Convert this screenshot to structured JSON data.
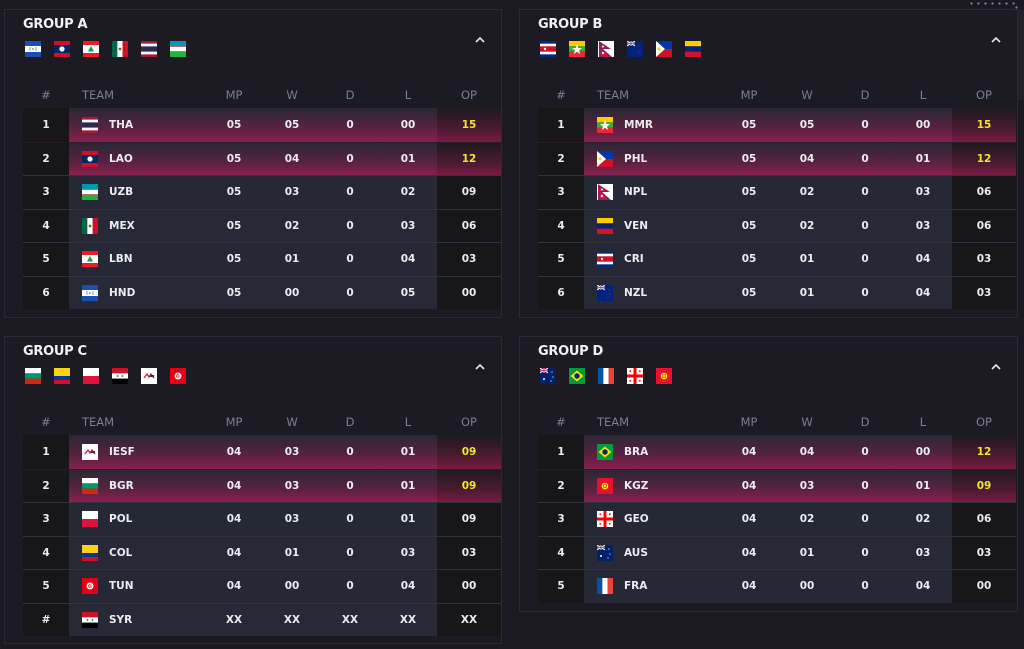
{
  "columns": {
    "rank": "#",
    "team": "TEAM",
    "mp": "MP",
    "w": "W",
    "d": "D",
    "l": "L",
    "op": "OP"
  },
  "colors": {
    "qualified_text": "#f0e62a",
    "qualified_row": "#8a1f4e",
    "background": "#1b1a22"
  },
  "collapse_icon": "chevron-up-icon",
  "groups": [
    {
      "title": "GROUP A",
      "flags": [
        "HND",
        "LAO",
        "LBN",
        "MEX",
        "THA",
        "UZB"
      ],
      "rows": [
        {
          "rank": "1",
          "team": "THA",
          "mp": "05",
          "w": "05",
          "d": "0",
          "l": "00",
          "op": "15",
          "qualified": true
        },
        {
          "rank": "2",
          "team": "LAO",
          "mp": "05",
          "w": "04",
          "d": "0",
          "l": "01",
          "op": "12",
          "qualified": true
        },
        {
          "rank": "3",
          "team": "UZB",
          "mp": "05",
          "w": "03",
          "d": "0",
          "l": "02",
          "op": "09",
          "qualified": false
        },
        {
          "rank": "4",
          "team": "MEX",
          "mp": "05",
          "w": "02",
          "d": "0",
          "l": "03",
          "op": "06",
          "qualified": false
        },
        {
          "rank": "5",
          "team": "LBN",
          "mp": "05",
          "w": "01",
          "d": "0",
          "l": "04",
          "op": "03",
          "qualified": false
        },
        {
          "rank": "6",
          "team": "HND",
          "mp": "05",
          "w": "00",
          "d": "0",
          "l": "05",
          "op": "00",
          "qualified": false
        }
      ]
    },
    {
      "title": "GROUP B",
      "flags": [
        "CRI",
        "MMR",
        "NPL",
        "NZL",
        "PHL",
        "VEN"
      ],
      "rows": [
        {
          "rank": "1",
          "team": "MMR",
          "mp": "05",
          "w": "05",
          "d": "0",
          "l": "00",
          "op": "15",
          "qualified": true
        },
        {
          "rank": "2",
          "team": "PHL",
          "mp": "05",
          "w": "04",
          "d": "0",
          "l": "01",
          "op": "12",
          "qualified": true
        },
        {
          "rank": "3",
          "team": "NPL",
          "mp": "05",
          "w": "02",
          "d": "0",
          "l": "03",
          "op": "06",
          "qualified": false
        },
        {
          "rank": "4",
          "team": "VEN",
          "mp": "05",
          "w": "02",
          "d": "0",
          "l": "03",
          "op": "06",
          "qualified": false
        },
        {
          "rank": "5",
          "team": "CRI",
          "mp": "05",
          "w": "01",
          "d": "0",
          "l": "04",
          "op": "03",
          "qualified": false
        },
        {
          "rank": "6",
          "team": "NZL",
          "mp": "05",
          "w": "01",
          "d": "0",
          "l": "04",
          "op": "03",
          "qualified": false
        }
      ]
    },
    {
      "title": "GROUP C",
      "flags": [
        "BGR",
        "COL",
        "POL",
        "SYR",
        "IESF",
        "TUN"
      ],
      "rows": [
        {
          "rank": "1",
          "team": "IESF",
          "mp": "04",
          "w": "03",
          "d": "0",
          "l": "01",
          "op": "09",
          "qualified": true
        },
        {
          "rank": "2",
          "team": "BGR",
          "mp": "04",
          "w": "03",
          "d": "0",
          "l": "01",
          "op": "09",
          "qualified": true
        },
        {
          "rank": "3",
          "team": "POL",
          "mp": "04",
          "w": "03",
          "d": "0",
          "l": "01",
          "op": "09",
          "qualified": false
        },
        {
          "rank": "4",
          "team": "COL",
          "mp": "04",
          "w": "01",
          "d": "0",
          "l": "03",
          "op": "03",
          "qualified": false
        },
        {
          "rank": "5",
          "team": "TUN",
          "mp": "04",
          "w": "00",
          "d": "0",
          "l": "04",
          "op": "00",
          "qualified": false
        },
        {
          "rank": "#",
          "team": "SYR",
          "mp": "XX",
          "w": "XX",
          "d": "XX",
          "l": "XX",
          "op": "XX",
          "qualified": false
        }
      ]
    },
    {
      "title": "GROUP D",
      "flags": [
        "AUS",
        "BRA",
        "FRA",
        "GEO",
        "KGZ"
      ],
      "rows": [
        {
          "rank": "1",
          "team": "BRA",
          "mp": "04",
          "w": "04",
          "d": "0",
          "l": "00",
          "op": "12",
          "qualified": true
        },
        {
          "rank": "2",
          "team": "KGZ",
          "mp": "04",
          "w": "03",
          "d": "0",
          "l": "01",
          "op": "09",
          "qualified": true
        },
        {
          "rank": "3",
          "team": "GEO",
          "mp": "04",
          "w": "02",
          "d": "0",
          "l": "02",
          "op": "06",
          "qualified": false
        },
        {
          "rank": "4",
          "team": "AUS",
          "mp": "04",
          "w": "01",
          "d": "0",
          "l": "03",
          "op": "03",
          "qualified": false
        },
        {
          "rank": "5",
          "team": "FRA",
          "mp": "04",
          "w": "00",
          "d": "0",
          "l": "04",
          "op": "00",
          "qualified": false
        }
      ]
    }
  ]
}
